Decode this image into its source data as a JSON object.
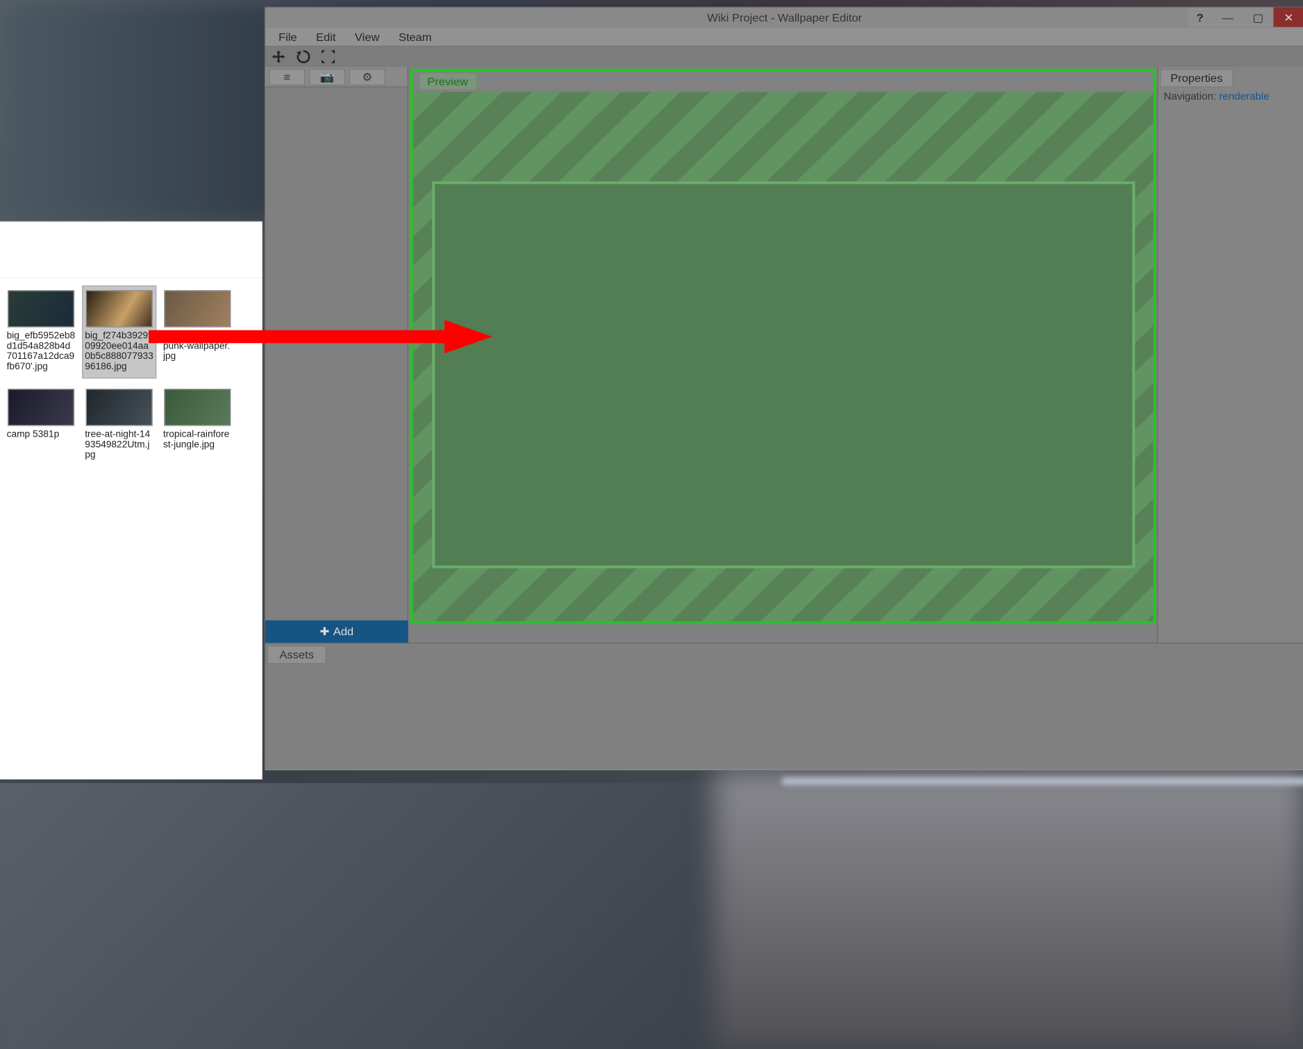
{
  "app": {
    "title": "Wiki Project - Wallpaper Editor"
  },
  "menu": {
    "file": "File",
    "edit": "Edit",
    "view": "View",
    "steam": "Steam"
  },
  "toolbar": {
    "move": "move-icon",
    "rotate": "rotate-icon",
    "fullscreen": "fullscreen-icon"
  },
  "leftpanel": {
    "list": "≡",
    "camera": "📷",
    "gear": "⚙",
    "add_label": "Add"
  },
  "preview": {
    "tab": "Preview"
  },
  "properties": {
    "tab": "Properties",
    "nav_label": "Navigation: ",
    "nav_link": "renderable"
  },
  "assets": {
    "tab": "Assets"
  },
  "explorer": {
    "files": [
      "big_efb5952eb8d1d54a828b4d701167a12dca9fb670'.jpg",
      "big_f274b3929f09920ee014aa0b5c88807793396186.jpg",
      "buldozer-steampunk-wallpaper.jpg",
      "camp                    5381p",
      "tree-at-night-1493549822Utm.jpg",
      "tropical-rainforest-jungle.jpg"
    ],
    "selected_index": 1
  }
}
